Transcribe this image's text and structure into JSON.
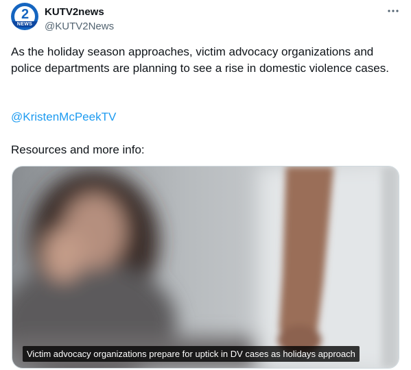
{
  "tweet": {
    "author": {
      "display_name": "KUTV2news",
      "handle": "@KUTV2News",
      "avatar_number": "2",
      "avatar_tag": "NEWS"
    },
    "more_icon": "more-horizontal-icon",
    "text": "As the holiday season approaches, victim advocacy organizations and police departments are planning to see a rise in domestic violence cases.",
    "mention": "@KristenMcPeekTV",
    "resources_label": "Resources and more info:",
    "media": {
      "caption": "Victim advocacy organizations prepare for uptick in DV cases as holidays approach"
    }
  },
  "colors": {
    "text": "#0f1419",
    "secondary": "#536471",
    "link": "#1d9bf0",
    "brand": "#1565c0"
  }
}
